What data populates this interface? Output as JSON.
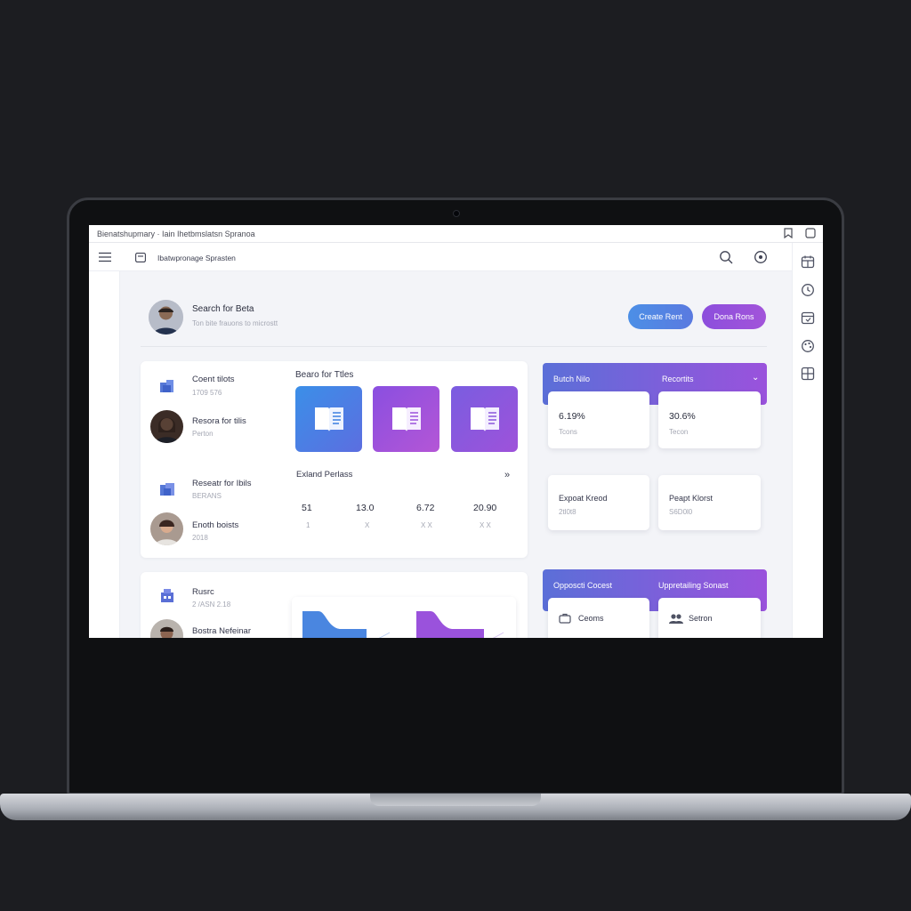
{
  "window": {
    "title": "Bienatshupmary · Iain Ihetbmslatsn Spranoa"
  },
  "topbar": {
    "breadcrumb": "Ibatwpronage Sprasten"
  },
  "header": {
    "title": "Search for Beta",
    "subtitle": "Ton bite frauons to microstt",
    "button_primary": "Create Rent",
    "button_secondary": "Dona Rons",
    "colors": {
      "primary": "#4a86e0",
      "secondary": "#8e4fdc"
    }
  },
  "left_list": [
    {
      "title": "Coent tilots",
      "sub": "1709 576",
      "icon": "document-blocks-icon"
    },
    {
      "title": "Resora for tilis",
      "sub": "Perton",
      "icon": "avatar-woman"
    },
    {
      "title": "Reseatr for Ibils",
      "sub": "BERANS",
      "icon": "stack-icon"
    },
    {
      "title": "Enoth boists",
      "sub": "2018",
      "icon": "avatar-woman-2"
    }
  ],
  "tiles_section": {
    "title": "Bearo for Ttles",
    "tiles": [
      {
        "icon": "book-icon",
        "gradient": [
          "#3b8fe8",
          "#5c6ee0"
        ]
      },
      {
        "icon": "book-icon",
        "gradient": [
          "#8a4fe0",
          "#b456d6"
        ]
      },
      {
        "icon": "book-icon",
        "gradient": [
          "#7a5de0",
          "#9e52da"
        ]
      }
    ]
  },
  "stats": {
    "title": "Exland Perlass",
    "more": "»",
    "values": [
      "51",
      "13.0",
      "6.72",
      "20.90"
    ],
    "subs": [
      "1",
      "X",
      "X X",
      "X X"
    ]
  },
  "right_top": {
    "header_left": "Butch Nilo",
    "header_right": "Recortits",
    "header_chevron": "⌄",
    "cards": [
      {
        "value": "6.19%",
        "sub": "Tcons"
      },
      {
        "value": "30.6%",
        "sub": "Tecon"
      }
    ]
  },
  "right_mid": {
    "cards": [
      {
        "title": "Expoat Kreod",
        "sub": "2tl0t8"
      },
      {
        "title": "Peapt Klorst",
        "sub": "S6D0l0"
      }
    ]
  },
  "bottom_left": {
    "items": [
      {
        "title": "Rusrc",
        "sub": "2 /ASN 2.18"
      },
      {
        "title": "Bostra Nefeinar",
        "sub": ""
      }
    ]
  },
  "right_bottom": {
    "header_left": "Opposcti Cocest",
    "header_right": "Uppretailing Sonast",
    "cards": [
      {
        "title": "Ceoms",
        "sub": ""
      },
      {
        "title": "Setron",
        "sub": ""
      }
    ]
  },
  "rail_icons": [
    "calendar-icon",
    "clock-icon",
    "calendar-check-icon",
    "palette-icon",
    "grid-icon"
  ]
}
